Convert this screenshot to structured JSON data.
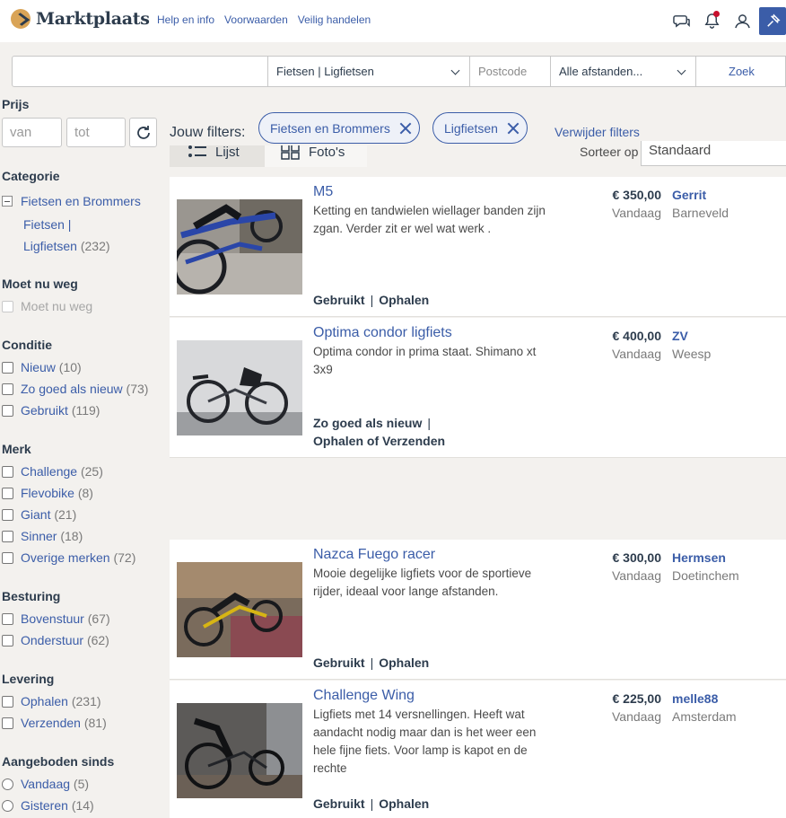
{
  "header": {
    "logo": "Marktplaats",
    "links": [
      "Help en info",
      "Voorwaarden",
      "Veilig handelen"
    ]
  },
  "search": {
    "query": "",
    "category": "Fietsen | Ligfietsen",
    "postcode_placeholder": "Postcode",
    "distance": "Alle afstanden...",
    "button": "Zoek"
  },
  "sidebar": {
    "price_heading": "Prijs",
    "price_from_placeholder": "van",
    "price_to_placeholder": "tot",
    "category_heading": "Categorie",
    "category_parent": "Fietsen en Brommers",
    "category_child_line1": "Fietsen |",
    "category_child_line2": "Ligfietsen",
    "category_child_count": "(232)",
    "moet_heading": "Moet nu weg",
    "moet_option": "Moet nu weg",
    "conditie_heading": "Conditie",
    "conditie": [
      {
        "label": "Nieuw",
        "count": "(10)"
      },
      {
        "label": "Zo goed als nieuw",
        "count": "(73)"
      },
      {
        "label": "Gebruikt",
        "count": "(119)"
      }
    ],
    "merk_heading": "Merk",
    "merk": [
      {
        "label": "Challenge",
        "count": "(25)"
      },
      {
        "label": "Flevobike",
        "count": "(8)"
      },
      {
        "label": "Giant",
        "count": "(21)"
      },
      {
        "label": "Sinner",
        "count": "(18)"
      },
      {
        "label": "Overige merken",
        "count": "(72)"
      }
    ],
    "besturing_heading": "Besturing",
    "besturing": [
      {
        "label": "Bovenstuur",
        "count": "(67)"
      },
      {
        "label": "Onderstuur",
        "count": "(62)"
      }
    ],
    "levering_heading": "Levering",
    "levering": [
      {
        "label": "Ophalen",
        "count": "(231)"
      },
      {
        "label": "Verzenden",
        "count": "(81)"
      }
    ],
    "sinds_heading": "Aangeboden sinds",
    "sinds": [
      {
        "label": "Vandaag",
        "count": "(5)"
      },
      {
        "label": "Gisteren",
        "count": "(14)"
      }
    ]
  },
  "filters": {
    "label": "Jouw filters:",
    "chips": [
      "Fietsen en Brommers",
      "Ligfietsen"
    ],
    "clear": "Verwijder filters"
  },
  "view": {
    "list": "Lijst",
    "photos": "Foto's",
    "sort_label": "Sorteer op",
    "sort_value": "Standaard"
  },
  "listings": [
    {
      "title": "M5",
      "description": "Ketting en tandwielen wiellager banden zijn zgan. Verder zit er wel wat werk .",
      "attr1": "Gebruikt",
      "attr2": "Ophalen",
      "price": "€ 350,00",
      "date": "Vandaag",
      "seller": "Gerrit",
      "city": "Barneveld"
    },
    {
      "title": "Optima condor ligfiets",
      "description": "Optima condor in prima staat. Shimano xt 3x9",
      "attr1": "Zo goed als nieuw",
      "attr2": "Ophalen of Verzenden",
      "price": "€ 400,00",
      "date": "Vandaag",
      "seller": "ZV",
      "city": "Weesp"
    },
    {
      "title": "Nazca Fuego racer",
      "description": "Mooie degelijke ligfiets voor de sportieve rijder, ideaal voor lange afstanden.",
      "attr1": "Gebruikt",
      "attr2": "Ophalen",
      "price": "€ 300,00",
      "date": "Vandaag",
      "seller": "Hermsen",
      "city": "Doetinchem"
    },
    {
      "title": "Challenge Wing",
      "description": "Ligfiets met 14 versnellingen. Heeft wat aandacht nodig maar dan is het weer een hele fijne fiets. Voor lamp is kapot en de rechte",
      "attr1": "Gebruikt",
      "attr2": "Ophalen",
      "price": "€ 225,00",
      "date": "Vandaag",
      "seller": "melle88",
      "city": "Amsterdam"
    }
  ],
  "colors": {
    "link": "#3b5da8",
    "text": "#2d3c4d",
    "background": "#f3f1ee",
    "logo_accent": "#d9a457",
    "notification_dot": "#c8102e"
  }
}
